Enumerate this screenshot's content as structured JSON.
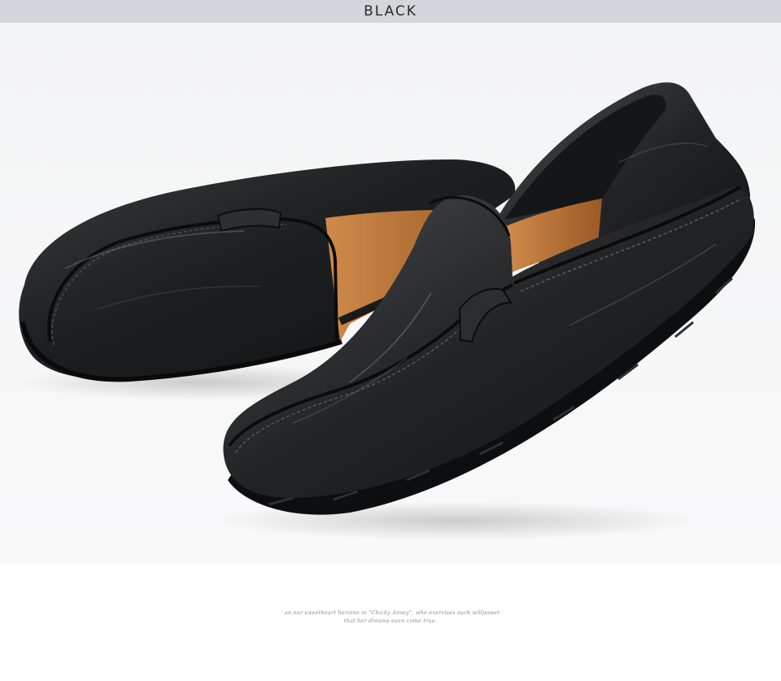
{
  "header": {
    "title": "BLACK"
  },
  "product_image": {
    "subject": "pair-of-loafers-icon",
    "colors": {
      "leather": "#1c1d1f",
      "lining": "#b86d2e",
      "backdrop": "#f5f6f7"
    }
  },
  "caption": {
    "line1": "· an ear sweetheart heroine in \"Chicky Ansey\", who exercises such willpower",
    "line2": "that her dreams even come true."
  }
}
